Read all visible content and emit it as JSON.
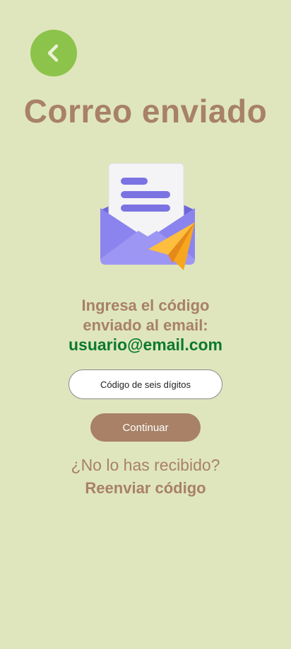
{
  "header": {
    "back_icon": "chevron-left-icon",
    "title": "Correo enviado"
  },
  "illustration": {
    "icon": "envelope-paper-plane-icon"
  },
  "instructions": {
    "line1": "Ingresa el código",
    "line2": "enviado al email:",
    "email": "usuario@email.com"
  },
  "form": {
    "code_placeholder": "Código de seis dígitos",
    "code_value": "",
    "continue_label": "Continuar"
  },
  "footer": {
    "not_received": "¿No lo has recibido?",
    "resend_label": "Reenviar código"
  },
  "colors": {
    "background": "#dfe6bd",
    "accent_green": "#8cc34a",
    "brown": "#a88166",
    "email_green": "#0b7a2e"
  }
}
